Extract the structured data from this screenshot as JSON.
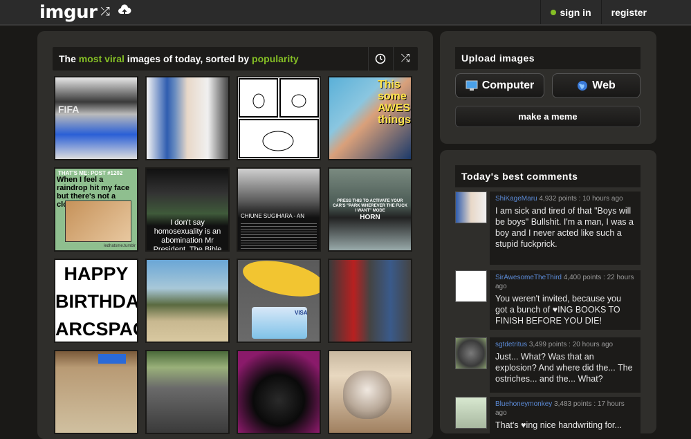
{
  "nav": {
    "logo": "imgur",
    "sign_in": "sign in",
    "register": "register"
  },
  "gallery": {
    "title_prefix": "The ",
    "title_hl1": "most viral",
    "title_mid": " images of today, sorted by ",
    "title_hl2": "popularity",
    "tiles": [
      {
        "caption": "FIFA"
      },
      {
        "caption": ""
      },
      {
        "caption": ""
      },
      {
        "caption": "This some AWES things"
      },
      {
        "caption": "When I feel a raindrop hit my face but there's not a cloud in the sky:",
        "sub": "THAT'S ME: POST #1202",
        "credit": "ledhatsme.tumblr"
      },
      {
        "caption": "I don't say homosexuality is an abomination Mr President. The Bible does."
      },
      {
        "caption": "CHIUNE SUGIHARA - AN UNSUNG HERO"
      },
      {
        "caption": "PRESS THIS TO ACTIVATE YOUR CAR'S \"PARK WHEREVER THE FUCK I WANT\" MODE",
        "sub": "HORN"
      },
      {
        "line1": "HAPPY",
        "line2": "BIRTHDAY",
        "line3": "ARCSPACE"
      },
      {
        "caption": ""
      },
      {
        "caption": "VISA"
      },
      {
        "caption": ""
      },
      {
        "caption": ""
      },
      {
        "caption": ""
      },
      {
        "caption": ""
      },
      {
        "caption": ""
      }
    ]
  },
  "upload": {
    "title": "Upload images",
    "computer": "Computer",
    "web": "Web",
    "meme": "make a meme"
  },
  "comments": {
    "title": "Today's best comments",
    "items": [
      {
        "user": "ShiKageMaru",
        "meta": " 4,932 points : 10 hours ago",
        "text": "I am sick and tired of that \"Boys will be boys\" Bullshit. I'm a man, I was a boy and I never acted like such a stupid fuckprick."
      },
      {
        "user": "SirAwesomeTheThird",
        "meta": " 4,400 points : 22 hours ago",
        "text": "You weren't invited, because you got a bunch of ♥ING BOOKS TO FINISH BEFORE YOU DIE!"
      },
      {
        "user": "sgtdetritus",
        "meta": " 3,499 points : 20 hours ago",
        "text": "Just... What? Was that an explosion? And where did the... The ostriches... and the... What?"
      },
      {
        "user": "Bluehoneymonkey",
        "meta": " 3,483 points : 17 hours ago",
        "text": "That's ♥ing nice handwriting for..."
      }
    ]
  }
}
